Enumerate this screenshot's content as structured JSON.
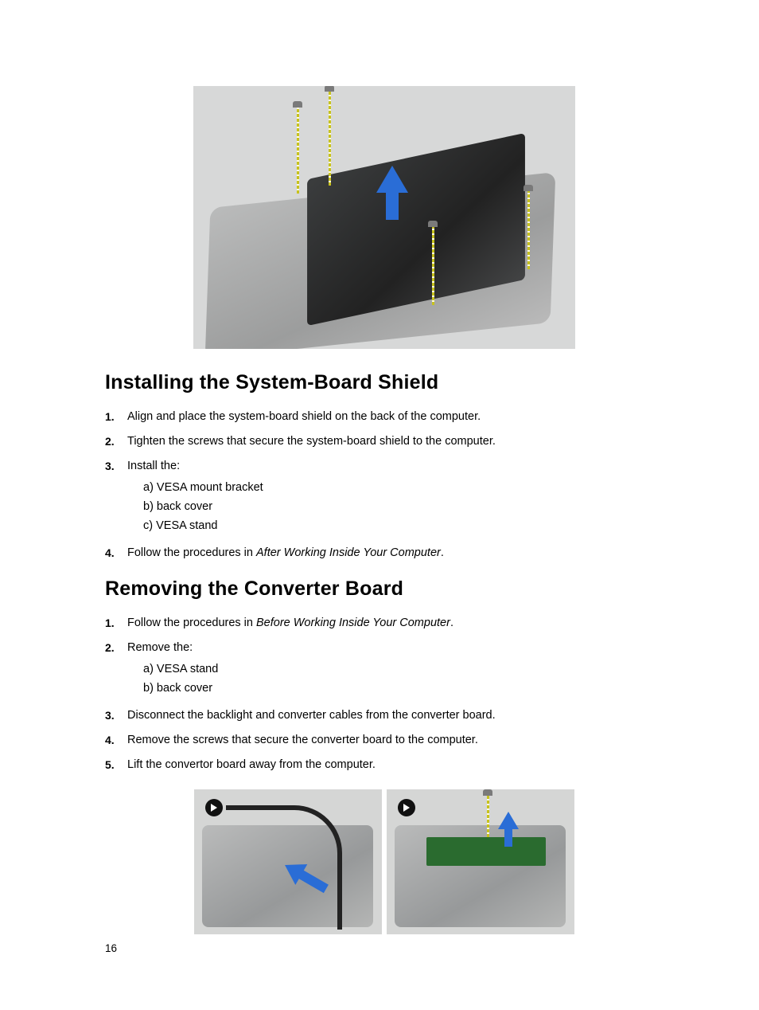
{
  "sections": {
    "install": {
      "heading": "Installing the System-Board Shield",
      "steps": [
        {
          "n": "1.",
          "text": "Align and place the system-board shield on the back of the computer."
        },
        {
          "n": "2.",
          "text": "Tighten the screws that secure the system-board shield to the computer."
        },
        {
          "n": "3.",
          "text": "Install the:",
          "sub": [
            "a)   VESA mount bracket",
            "b)   back cover",
            "c)   VESA stand"
          ]
        },
        {
          "n": "4.",
          "text_pre": "Follow the procedures in ",
          "text_em": "After Working Inside Your Computer",
          "text_post": "."
        }
      ]
    },
    "remove": {
      "heading": "Removing the Converter Board",
      "steps": [
        {
          "n": "1.",
          "text_pre": "Follow the procedures in ",
          "text_em": "Before Working Inside Your Computer",
          "text_post": "."
        },
        {
          "n": "2.",
          "text": "Remove the:",
          "sub": [
            "a)   VESA stand",
            "b)   back cover"
          ]
        },
        {
          "n": "3.",
          "text": "Disconnect the backlight and converter cables from the converter board."
        },
        {
          "n": "4.",
          "text": "Remove the screws that secure the converter board to the computer."
        },
        {
          "n": "5.",
          "text": "Lift the convertor board away from the computer."
        }
      ]
    }
  },
  "page_number": "16"
}
